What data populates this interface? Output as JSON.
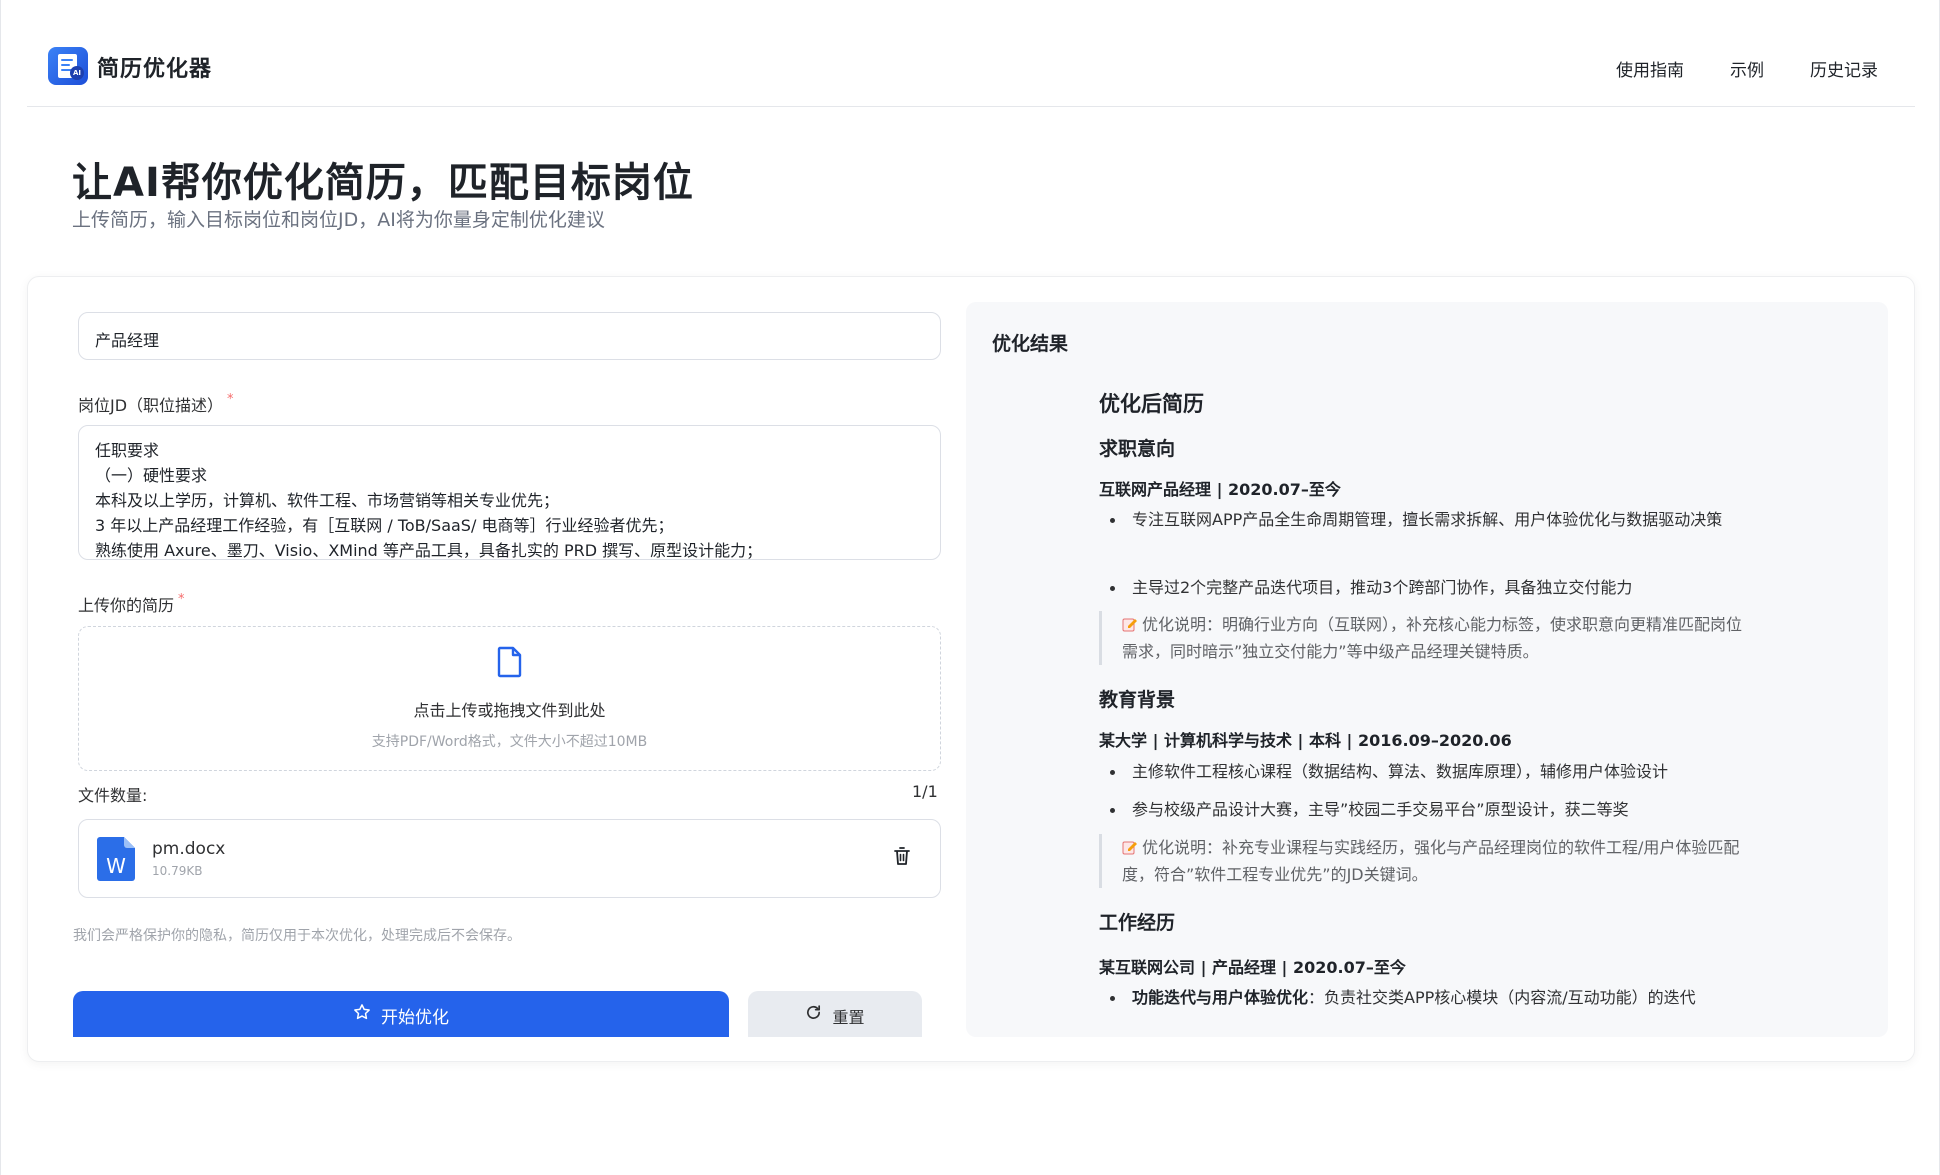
{
  "header": {
    "app_title": "简历优化器",
    "nav": [
      "使用指南",
      "示例",
      "历史记录"
    ],
    "logo_badge": "AI"
  },
  "hero": {
    "title": "让AI帮你优化简历，匹配目标岗位",
    "subtitle": "上传简历，输入目标岗位和岗位JD，AI将为你量身定制优化建议"
  },
  "form": {
    "position_value": "产品经理",
    "jd_label": "岗位JD（职位描述）",
    "required_mark": "*",
    "jd_lines": [
      "任职要求",
      "（一）硬性要求",
      "本科及以上学历，计算机、软件工程、市场营销等相关专业优先；",
      "3 年以上产品经理工作经验，有［互联网 / ToB/SaaS/ 电商等］行业经验者优先；",
      "熟练使用 Axure、墨刀、Visio、XMind 等产品工具，具备扎实的 PRD 撰写、原型设计能力；"
    ],
    "upload_label": "上传你的简历",
    "upload_text": "点击上传或拖拽文件到此处",
    "upload_hint": "支持PDF/Word格式，文件大小不超过10MB",
    "count_label": "文件数量:",
    "count_value": "1/1",
    "file": {
      "name": "pm.docx",
      "size": "10.79KB",
      "icon_letter": "W"
    },
    "privacy": "我们会严格保护你的隐私，简历仅用于本次优化，处理完成后不会保存。",
    "start_label": "开始优化",
    "reset_label": "重置"
  },
  "result": {
    "title": "优化结果",
    "doc_title": "优化后简历",
    "sec1_title": "求职意向",
    "sec1_sub": "互联网产品经理 | 2020.07–至今",
    "sec1_li1": "专注互联网APP产品全生命周期管理，擅长需求拆解、用户体验优化与数据驱动决策",
    "sec1_li2": "主导过2个完整产品迭代项目，推动3个跨部门协作，具备独立交付能力",
    "note_label": "优化说明",
    "sec1_note": "：明确行业方向（互联网），补充核心能力标签，使求职意向更精准匹配岗位需求，同时暗示”独立交付能力”等中级产品经理关键特质。",
    "sec2_title": "教育背景",
    "sec2_sub": "某大学 | 计算机科学与技术 | 本科 | 2016.09–2020.06",
    "sec2_li1": "主修软件工程核心课程（数据结构、算法、数据库原理），辅修用户体验设计",
    "sec2_li2": "参与校级产品设计大赛，主导”校园二手交易平台”原型设计，获二等奖",
    "sec2_note": "：补充专业课程与实践经历，强化与产品经理岗位的软件工程/用户体验匹配度，符合”软件工程专业优先”的JD关键词。",
    "sec3_title": "工作经历",
    "sec3_sub": "某互联网公司 | 产品经理 | 2020.07–至今",
    "sec3_li1_bold": "功能迭代与用户体验优化",
    "sec3_li1_rest": "：负责社交类APP核心模块（内容流/互动功能）的迭代"
  }
}
